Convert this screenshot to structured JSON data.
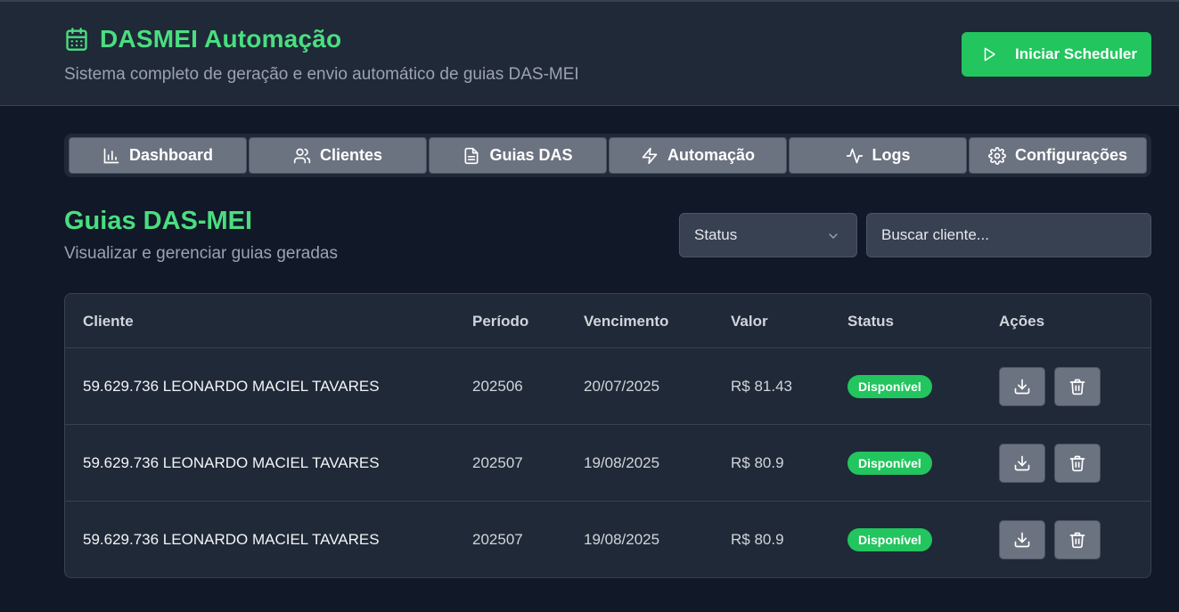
{
  "header": {
    "title": "DASMEI Automação",
    "subtitle": "Sistema completo de geração e envio automático de guias DAS-MEI",
    "scheduler_button": "Iniciar Scheduler",
    "accent_color": "#4ade80"
  },
  "tabs": [
    {
      "label": "Dashboard",
      "icon": "bar-chart-icon"
    },
    {
      "label": "Clientes",
      "icon": "users-icon"
    },
    {
      "label": "Guias DAS",
      "icon": "file-text-icon"
    },
    {
      "label": "Automação",
      "icon": "lightning-icon"
    },
    {
      "label": "Logs",
      "icon": "activity-icon"
    },
    {
      "label": "Configurações",
      "icon": "gear-icon"
    }
  ],
  "section": {
    "title": "Guias DAS-MEI",
    "subtitle": "Visualizar e gerenciar guias geradas"
  },
  "filters": {
    "status_selected": "Status",
    "search_placeholder": "Buscar cliente..."
  },
  "table": {
    "columns": [
      "Cliente",
      "Período",
      "Vencimento",
      "Valor",
      "Status",
      "Ações"
    ],
    "rows": [
      {
        "cliente": "59.629.736 LEONARDO MACIEL TAVARES",
        "periodo": "202506",
        "vencimento": "20/07/2025",
        "valor": "R$ 81.43",
        "status": "Disponível"
      },
      {
        "cliente": "59.629.736 LEONARDO MACIEL TAVARES",
        "periodo": "202507",
        "vencimento": "19/08/2025",
        "valor": "R$ 80.9",
        "status": "Disponível"
      },
      {
        "cliente": "59.629.736 LEONARDO MACIEL TAVARES",
        "periodo": "202507",
        "vencimento": "19/08/2025",
        "valor": "R$ 80.9",
        "status": "Disponível"
      }
    ],
    "status_color": "#22c55e"
  }
}
